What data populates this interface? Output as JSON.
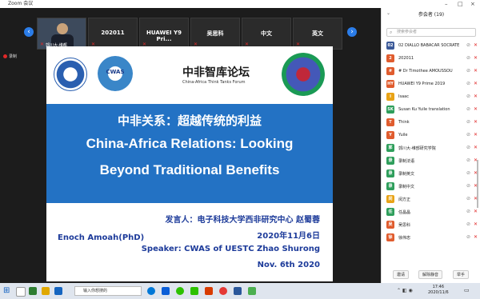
{
  "window": {
    "title": "Zoom 会议"
  },
  "thumbnails": [
    {
      "label": "",
      "name": "郭川大-维都",
      "is_video": true
    },
    {
      "label": "202011",
      "name": ""
    },
    {
      "label": "HUAWEI Y9 Pri...",
      "name": ""
    },
    {
      "label": "吴思科",
      "name": ""
    },
    {
      "label": "中文",
      "name": ""
    },
    {
      "label": "英文",
      "name": ""
    }
  ],
  "recording": {
    "label": "录制"
  },
  "slide": {
    "logo2_text": "CWAS",
    "forum_cn": "中非智库论坛",
    "forum_en": "China-Africa Think Tanks Forum",
    "title_cn": "中非关系：超越传统的利益",
    "title_en_line1": "China-Africa Relations: Looking",
    "title_en_line2": "Beyond Traditional Benefits",
    "speaker_cn": "发言人：电子科技大学西非研究中心  赵蜀蓉",
    "date_cn": "2020年11月6日",
    "speaker_en": "Speaker: CWAS of UESTC  Zhao Shurong",
    "date_en": "Nov. 6th 2020",
    "author": "Enoch Amoah(PhD)"
  },
  "participants": {
    "header": "参会者 (19)",
    "search_placeholder": "搜索参会者",
    "list": [
      {
        "initials": "02",
        "name": "02 DIALLO BABACAR SOCRATE",
        "color": "#3b5998"
      },
      {
        "initials": "2",
        "name": "202011",
        "color": "#e05c2e"
      },
      {
        "initials": "#",
        "name": "# Dr Timothee AMOUSSOU",
        "color": "#e05c2e"
      },
      {
        "initials": "HY",
        "name": "HUAWEI Y9 Prime 2019",
        "color": "#e05c2e"
      },
      {
        "initials": "I",
        "name": "Isaac",
        "color": "#e8a317"
      },
      {
        "initials": "SK",
        "name": "Susan Ku Yuile translation",
        "color": "#2e9e5b"
      },
      {
        "initials": "T",
        "name": "Think",
        "color": "#e05c2e"
      },
      {
        "initials": "Y",
        "name": "Yuile",
        "color": "#e05c2e"
      },
      {
        "initials": "郭",
        "name": "郭川大-维部研究学院",
        "color": "#2e9e5b"
      },
      {
        "initials": "录",
        "name": "录制法语",
        "color": "#2e9e5b"
      },
      {
        "initials": "录",
        "name": "录制英文",
        "color": "#2e9e5b"
      },
      {
        "initials": "录",
        "name": "录制中文",
        "color": "#2e9e5b"
      },
      {
        "initials": "闵",
        "name": "闵方正",
        "color": "#e8a317"
      },
      {
        "initials": "任",
        "name": "任晶晶",
        "color": "#2e9e5b"
      },
      {
        "initials": "吴",
        "name": "吴思科",
        "color": "#e05c2e"
      },
      {
        "initials": "徐",
        "name": "徐伟忠",
        "color": "#e05c2e"
      }
    ],
    "footer": {
      "invite": "邀请",
      "unmute_all": "解除静音",
      "raise_hand": "举手"
    }
  },
  "taskbar": {
    "search_placeholder": "输入你想搜的",
    "time": "17:46",
    "date": "2020/11/6"
  },
  "colors": {
    "slide_band": "#2372c4",
    "speaker_text": "#1d3b9a",
    "zoom_bg": "#1c1c1c"
  }
}
